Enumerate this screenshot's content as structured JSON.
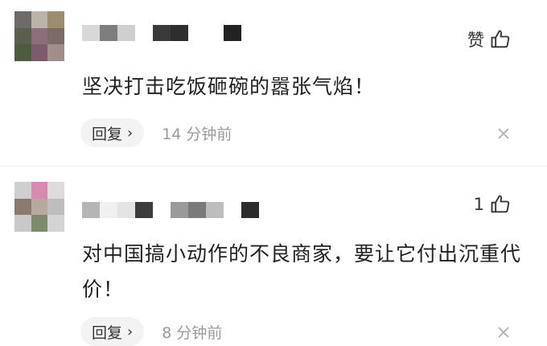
{
  "comments": [
    {
      "likes": "赞",
      "text": "坚决打击吃饭砸碗的嚣张气焰！",
      "reply_label": "回复",
      "time": "14 分钟前",
      "avatar_colors": [
        "#6f6a6a",
        "#b9b3a9",
        "#9c8d6f",
        "#5b5f4d",
        "#8a6f7a",
        "#7b6c67",
        "#4f5b3f",
        "#7e5a6d",
        "#a18e8a"
      ],
      "name_colors": [
        "#d8d8d8",
        "#7d7d7d",
        "#cfcfcf",
        "#ffffff",
        "#3a3a3a",
        "#2e2e2e",
        "#ffffff",
        "#ffffff",
        "#222222"
      ]
    },
    {
      "likes": "1",
      "text": "对中国搞小动作的不良商家，要让它付出沉重代价！",
      "reply_label": "回复",
      "time": "8 分钟前",
      "avatar_colors": [
        "#cfcfcf",
        "#d58ab0",
        "#dcdcdc",
        "#8c7a70",
        "#b8a9a0",
        "#bdbdbd",
        "#c9c9c9",
        "#7d8a6c",
        "#d4d4d4"
      ],
      "name_colors": [
        "#b5b5b5",
        "#f0f0f0",
        "#e4e4e4",
        "#3c3c3c",
        "#ffffff",
        "#9a9a9a",
        "#7a7a7a",
        "#bdbdbd",
        "#ffffff",
        "#2c2c2c"
      ]
    }
  ]
}
